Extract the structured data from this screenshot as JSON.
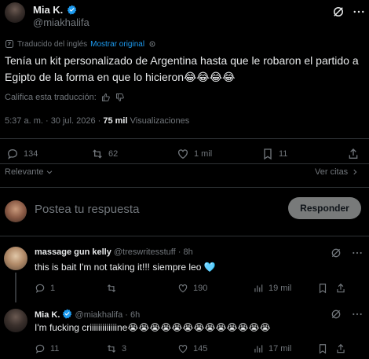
{
  "main_tweet": {
    "author_name": "Mia K.",
    "author_handle": "@miakhalifa",
    "translation_note": "Traducido del inglés",
    "show_original": "Mostrar original",
    "text": "Tenía un kit personalizado de Argentina hasta que le robaron el partido a Egipto de la forma en que lo hicieron😂😂😂😂",
    "rate_translation": "Califica esta traducción:",
    "timestamp": "5:37 a. m. · 30 jul. 2026 ·",
    "views_count": "75 mil",
    "views_label": "Visualizaciones",
    "stats": {
      "replies": "134",
      "retweets": "62",
      "likes": "1 mil",
      "bookmarks": "11"
    }
  },
  "sort": {
    "label": "Relevante",
    "quotes_link": "Ver citas"
  },
  "composer": {
    "placeholder": "Postea tu respuesta",
    "button": "Responder"
  },
  "replies": [
    {
      "author_name": "massage gun kelly",
      "author_handle": "@treswritesstuff · 8h",
      "text": "this is bait I'm not taking it!!! siempre leo 🩵",
      "stats": {
        "replies": "1",
        "retweets": "",
        "likes": "190",
        "views": "19 mil"
      }
    },
    {
      "author_name": "Mia K.",
      "author_handle": "@miakhalifa · 6h",
      "text": "I'm fucking criiiiiiiiiiiiine😭😭😭😭😭😭😭😭😭😭😭😭😭",
      "stats": {
        "replies": "11",
        "retweets": "3",
        "likes": "145",
        "views": "17 mil"
      }
    }
  ],
  "colors": {
    "background": "#000000",
    "text": "#e7e9ea",
    "muted": "#71767b",
    "link": "#1d9bf0",
    "verified": "#1d9bf0",
    "divider": "#2f3336"
  }
}
